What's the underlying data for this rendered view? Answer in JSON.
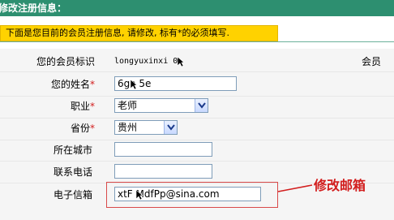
{
  "header": {
    "title": "修改注册信息："
  },
  "notice": {
    "text": "下面是您目前的会员注册信息, 请修改, 标有*的必须填写."
  },
  "form": {
    "member_id": {
      "label": "您的会员标识",
      "value": "longyuxinxi 0"
    },
    "name": {
      "label": "您的姓名",
      "required": "*",
      "value": "6ga 5e"
    },
    "occupation": {
      "label": "职业",
      "required": "*",
      "selected": "老师"
    },
    "province": {
      "label": "省份",
      "required": "*",
      "selected": "贵州"
    },
    "city": {
      "label": "所在城市",
      "value": ""
    },
    "phone": {
      "label": "联系电话",
      "value": ""
    },
    "email": {
      "label": "电子信箱",
      "value": "xtF MdfPp@sina.com"
    }
  },
  "right_column": {
    "label": "会员"
  },
  "annotation": {
    "text": "修改邮箱",
    "color": "#d21d1d"
  },
  "colors": {
    "header_bg": "#2d8f70",
    "notice_bg": "#ffd200",
    "form_bg": "#f5f5f5"
  },
  "icons": {
    "select_arrow": "chevron-down-icon",
    "cursor": "cursor-icon",
    "annotation_arrow": "arrow-left-icon"
  }
}
